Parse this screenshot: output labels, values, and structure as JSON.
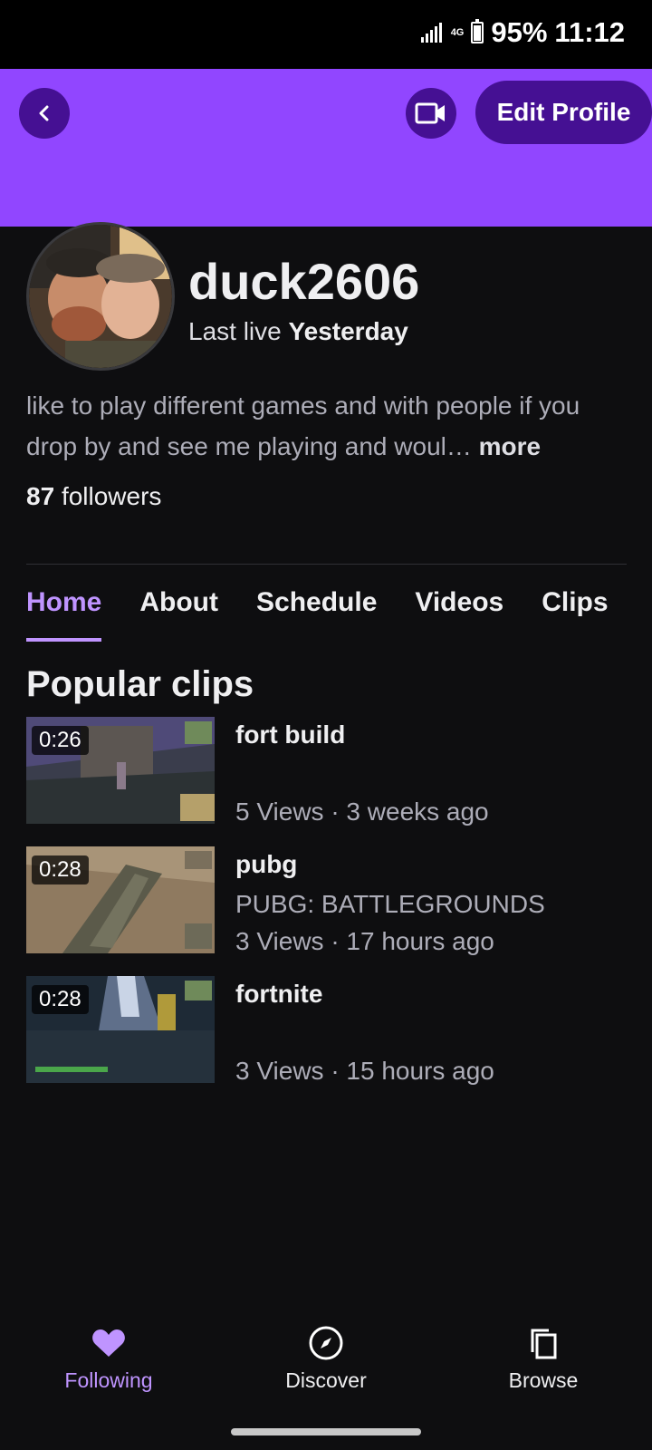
{
  "status_bar": {
    "network": "4G",
    "battery": "95%",
    "time": "11:12"
  },
  "header": {
    "edit_profile_label": "Edit Profile"
  },
  "profile": {
    "username": "duck2606",
    "last_live_prefix": "Last live",
    "last_live_value": "Yesterday",
    "bio_text": "like to play different games and with people if you drop by and see me playing and woul…",
    "bio_more": "more",
    "followers_count": "87",
    "followers_label": "followers"
  },
  "tabs": [
    "Home",
    "About",
    "Schedule",
    "Videos",
    "Clips"
  ],
  "active_tab": "Home",
  "section_title": "Popular clips",
  "clips": [
    {
      "duration": "0:26",
      "title": "fort build",
      "game": "",
      "meta": "5 Views · 3 weeks ago"
    },
    {
      "duration": "0:28",
      "title": "pubg",
      "game": "PUBG: BATTLEGROUNDS",
      "meta": "3 Views · 17 hours ago"
    },
    {
      "duration": "0:28",
      "title": "fortnite",
      "game": "",
      "meta": "3 Views · 15 hours ago"
    }
  ],
  "bottom_nav": [
    {
      "label": "Following",
      "icon": "heart-icon",
      "active": true
    },
    {
      "label": "Discover",
      "icon": "compass-icon",
      "active": false
    },
    {
      "label": "Browse",
      "icon": "copy-icon",
      "active": false
    }
  ],
  "colors": {
    "brand": "#9146ff",
    "accent": "#bf94ff",
    "background": "#0e0e10",
    "button_dark": "#451093"
  }
}
